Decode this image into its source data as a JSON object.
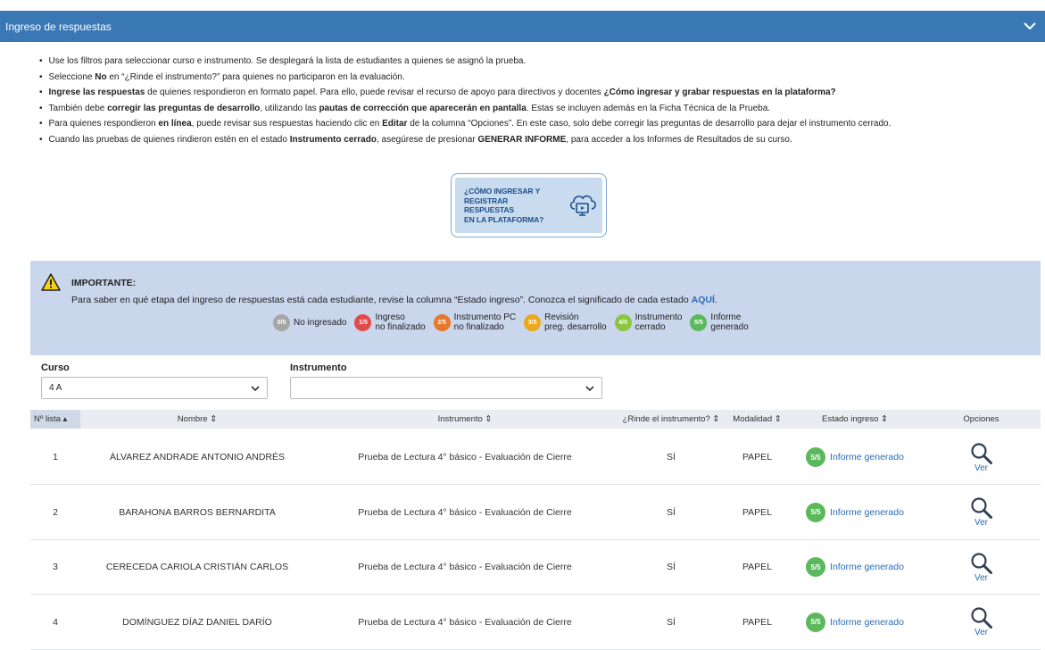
{
  "header": {
    "title": "Ingreso de respuestas"
  },
  "instructions": [
    {
      "parts": [
        {
          "t": "Use los filtros para seleccionar curso e instrumento. Se desplegará la lista de estudiantes a quienes se asignó la prueba.",
          "b": false
        }
      ]
    },
    {
      "parts": [
        {
          "t": "Seleccione ",
          "b": false
        },
        {
          "t": "No",
          "b": true
        },
        {
          "t": " en “¿Rinde el instrumento?” para quienes no participaron en la evaluación.",
          "b": false
        }
      ]
    },
    {
      "parts": [
        {
          "t": "Ingrese las respuestas",
          "b": true
        },
        {
          "t": " de quienes respondieron en formato papel. Para ello, puede revisar el recurso de apoyo para directivos y docentes ",
          "b": false
        },
        {
          "t": "¿Cómo ingresar y grabar respuestas en la plataforma?",
          "b": true
        }
      ]
    },
    {
      "parts": [
        {
          "t": "También debe ",
          "b": false
        },
        {
          "t": "corregir las preguntas de desarrollo",
          "b": true
        },
        {
          "t": ", utilizando las ",
          "b": false
        },
        {
          "t": "pautas de corrección que aparecerán en pantalla",
          "b": true
        },
        {
          "t": ". Estas se incluyen además en la Ficha Técnica de la Prueba.",
          "b": false
        }
      ]
    },
    {
      "parts": [
        {
          "t": "Para quienes respondieron ",
          "b": false
        },
        {
          "t": "en línea",
          "b": true
        },
        {
          "t": ", puede revisar sus respuestas haciendo clic en ",
          "b": false
        },
        {
          "t": "Editar",
          "b": true
        },
        {
          "t": " de la columna “Opciones”. En este caso, solo debe corregir las preguntas de desarrollo para dejar el instrumento cerrado.",
          "b": false
        }
      ]
    },
    {
      "parts": [
        {
          "t": "Cuando las pruebas de quienes rindieron estén en el estado ",
          "b": false
        },
        {
          "t": "Instrumento cerrado",
          "b": true
        },
        {
          "t": ", asegúrese de presionar ",
          "b": false
        },
        {
          "t": "GENERAR INFORME",
          "b": true
        },
        {
          "t": ", para acceder a los Informes de Resultados de su curso.",
          "b": false
        }
      ]
    }
  ],
  "help_button": {
    "line1": "¿Cómo ingresar y",
    "line2": "registrar respuestas",
    "line3": "en la plataforma?"
  },
  "important": {
    "title": "IMPORTANTE:",
    "text": "Para saber en qué etapa del ingreso de respuestas está cada estudiante, revise la columna “Estado ingreso”. Conozca el significado de cada estado ",
    "link": "AQUÍ",
    "text_end": "."
  },
  "legend": [
    {
      "badge": "0/5",
      "label": "No ingresado",
      "color": "#a6a6a6"
    },
    {
      "badge": "1/5",
      "label": "Ingreso\nno finalizado",
      "color": "#e34a4a"
    },
    {
      "badge": "2/5",
      "label": "Instrumento PC\nno finalizado",
      "color": "#e8772a"
    },
    {
      "badge": "3/5",
      "label": "Revisión\npreg. desarrollo",
      "color": "#eba91b"
    },
    {
      "badge": "4/5",
      "label": "Instrumento\ncerrado",
      "color": "#8cc63f"
    },
    {
      "badge": "5/5",
      "label": "Informe\ngenerado",
      "color": "#5cb85c"
    }
  ],
  "filters": {
    "curso_label": "Curso",
    "curso_value": "4 A",
    "instrumento_label": "Instrumento",
    "instrumento_value": ""
  },
  "table": {
    "headers": {
      "n": "Nº lista ▴",
      "name": "Nombre ⇕",
      "inst": "Instrumento ⇕",
      "rinde": "¿Rinde el instrumento? ⇕",
      "mod": "Modalidad ⇕",
      "estado": "Estado ingreso ⇕",
      "op": "Opciones"
    },
    "rows": [
      {
        "n": "1",
        "name": "ÁLVAREZ ANDRADE ANTONIO ANDRÉS",
        "inst": "Prueba de Lectura 4° básico - Evaluación de Cierre",
        "rinde": "SÍ",
        "mod": "PAPEL",
        "badge": "5/5",
        "estado": "Informe generado",
        "op": "Ver"
      },
      {
        "n": "2",
        "name": "BARAHONA BARROS BERNARDITA",
        "inst": "Prueba de Lectura 4° básico - Evaluación de Cierre",
        "rinde": "SÍ",
        "mod": "PAPEL",
        "badge": "5/5",
        "estado": "Informe generado",
        "op": "Ver"
      },
      {
        "n": "3",
        "name": "CERECEDA CARIOLA CRISTIÁN CARLOS",
        "inst": "Prueba de Lectura 4° básico - Evaluación de Cierre",
        "rinde": "SÍ",
        "mod": "PAPEL",
        "badge": "5/5",
        "estado": "Informe generado",
        "op": "Ver"
      },
      {
        "n": "4",
        "name": "DOMÍNGUEZ DÍAZ DANIEL DARÍO",
        "inst": "Prueba de Lectura 4° básico - Evaluación de Cierre",
        "rinde": "SÍ",
        "mod": "PAPEL",
        "badge": "5/5",
        "estado": "Informe generado",
        "op": "Ver"
      }
    ]
  },
  "icons": {
    "expand": "chevron-down-icon",
    "warning": "warning-icon",
    "help": "cloud-monitor-icon",
    "view": "magnifier-icon"
  },
  "colors": {
    "header": "#3a78b5",
    "link": "#2a6bb5",
    "important_bg": "#c9d6ec",
    "done": "#5cb85c"
  }
}
